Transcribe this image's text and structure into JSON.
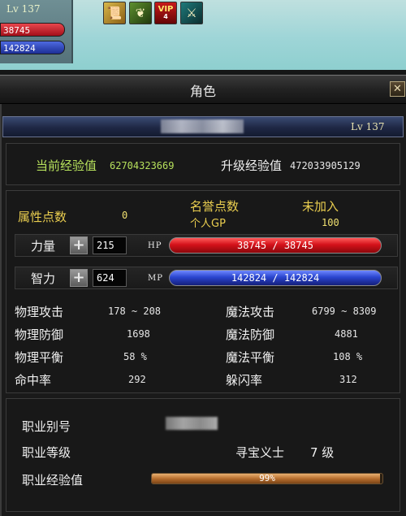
{
  "hud": {
    "level": "Lv 137",
    "hp": "38745",
    "mp": "142824",
    "buffs": [
      {
        "icon": "scroll-buff-icon"
      },
      {
        "icon": "herb-buff-icon"
      },
      {
        "icon": "vip-buff-icon",
        "text": "VIP",
        "sub": "4"
      },
      {
        "icon": "sword-buff-icon"
      }
    ]
  },
  "window": {
    "title": "角色",
    "close": "✕",
    "character_level": "Lv 137"
  },
  "experience": {
    "current_label": "当前经验值",
    "current_value": "62704323669",
    "next_label": "升级经验值",
    "next_value": "472033905129"
  },
  "points": {
    "attr_label": "属性点数",
    "attr_value": "0",
    "honor_label": "名誉点数",
    "honor_status": "未加入",
    "gp_label": "个人GP",
    "gp_value": "100"
  },
  "strength": {
    "label": "力量",
    "plus": "+",
    "value": "215",
    "bar_label": "HP",
    "bar_text": "38745 / 38745",
    "fill": 1.0
  },
  "intelligence": {
    "label": "智力",
    "plus": "+",
    "value": "624",
    "bar_label": "MP",
    "bar_text": "142824 / 142824",
    "fill": 1.0
  },
  "stats": [
    {
      "label": "物理攻击",
      "value": "178 ~ 208"
    },
    {
      "label": "魔法攻击",
      "value": "6799 ~ 8309"
    },
    {
      "label": "物理防御",
      "value": "1698"
    },
    {
      "label": "魔法防御",
      "value": "4881"
    },
    {
      "label": "物理平衡",
      "value": "58 %"
    },
    {
      "label": "魔法平衡",
      "value": "108 %"
    },
    {
      "label": "命中率",
      "value": "292"
    },
    {
      "label": "躲闪率",
      "value": "312"
    }
  ],
  "job": {
    "alias_label": "职业别号",
    "level_label": "职业等级",
    "job_name": "寻宝义士",
    "job_level": "7 级",
    "exp_label": "职业经验值",
    "exp_text": "99%",
    "exp_fill": 0.99
  }
}
